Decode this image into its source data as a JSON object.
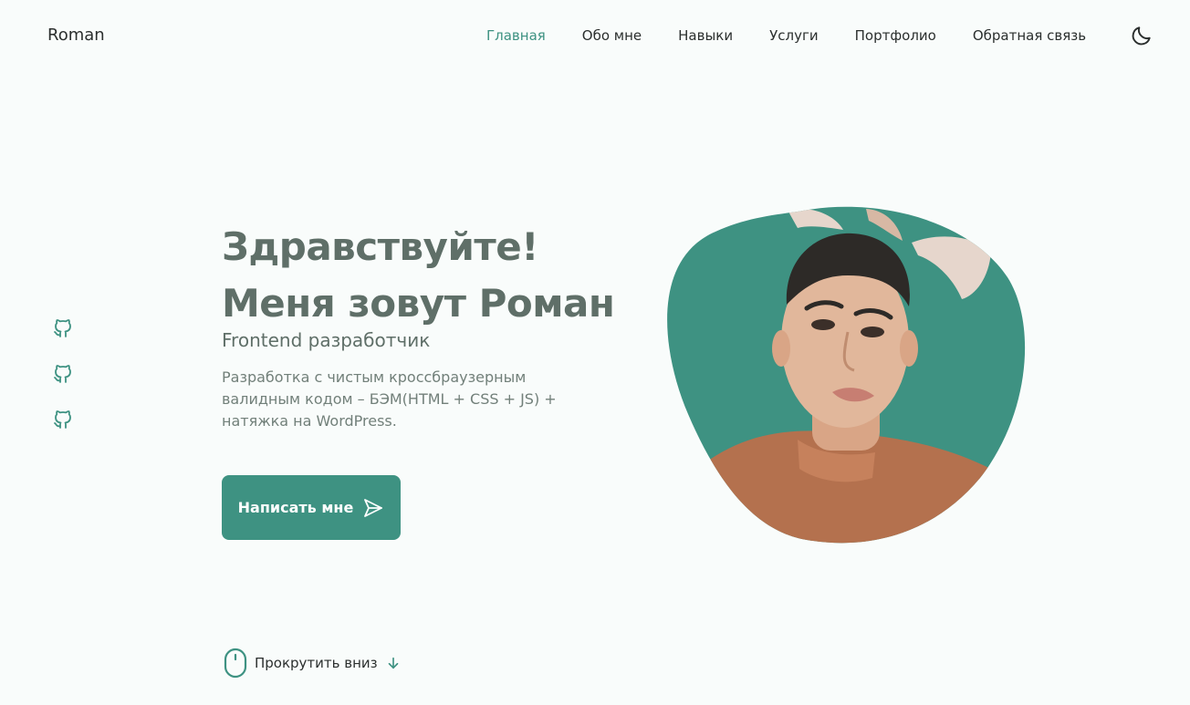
{
  "header": {
    "logo": "Roman",
    "nav": [
      {
        "label": "Главная",
        "active": true
      },
      {
        "label": "Обо мне"
      },
      {
        "label": "Навыки"
      },
      {
        "label": "Услуги"
      },
      {
        "label": "Портфолио"
      },
      {
        "label": "Обратная связь"
      }
    ],
    "theme_icon": "moon-icon"
  },
  "socials": [
    "github-icon",
    "github-icon",
    "github-icon"
  ],
  "hero": {
    "title_line1": "Здравствуйте!",
    "title_line2": "Меня зовут Роман",
    "subtitle": "Frontend разработчик",
    "description": "Разработка с чистым кроссбраузерным валидным кодом – БЭМ(HTML + CSS + JS) + натяжка на WordPress.",
    "cta_label": "Написать мне",
    "cta_icon": "send-icon"
  },
  "scroll": {
    "label": "Прокрутить вниз",
    "mouse_icon": "mouse-icon",
    "arrow_icon": "arrow-down-icon"
  },
  "colors": {
    "accent": "#3e9282",
    "text": "#5f6f68",
    "background": "#f9fcfb"
  }
}
